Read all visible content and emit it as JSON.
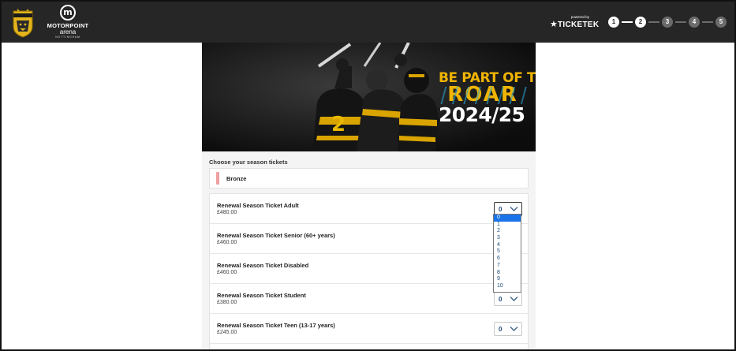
{
  "header": {
    "club_logo_icon": "nottingham-panthers-crest-icon",
    "venue": {
      "name": "MOTORPOINT",
      "sub": "arena",
      "city": "NOTTINGHAM"
    },
    "ticketek": {
      "powered": "powered by",
      "word": "TICKETEK",
      "star": "★"
    },
    "steps": [
      "1",
      "2",
      "3",
      "4",
      "5"
    ],
    "current_step": 2
  },
  "banner": {
    "line1": "BE PART OF THE",
    "line2": "ROAR",
    "line3": "2024/25",
    "jersey_text": "2",
    "colors": {
      "gold": "#f0b400",
      "white": "#ffffff",
      "background": "#0c0c0c"
    }
  },
  "content": {
    "heading": "Choose your season tickets",
    "tier": "Bronze",
    "tier_color": "#f0a0a0",
    "tickets": [
      {
        "name": "Renewal Season Ticket Adult",
        "price": "£480.00",
        "qty": "0"
      },
      {
        "name": "Renewal Season Ticket Senior (60+ years)",
        "price": "£460.00",
        "qty": "0"
      },
      {
        "name": "Renewal Season Ticket Disabled",
        "price": "£460.00",
        "qty": "0"
      },
      {
        "name": "Renewal Season Ticket Student",
        "price": "£380.00",
        "qty": "0"
      },
      {
        "name": "Renewal Season Ticket Teen (13-17 years)",
        "price": "£245.00",
        "qty": "0"
      }
    ]
  },
  "dropdown": {
    "options": [
      "0",
      "1",
      "2",
      "3",
      "4",
      "5",
      "6",
      "7",
      "8",
      "9",
      "10"
    ],
    "selected": "0"
  }
}
